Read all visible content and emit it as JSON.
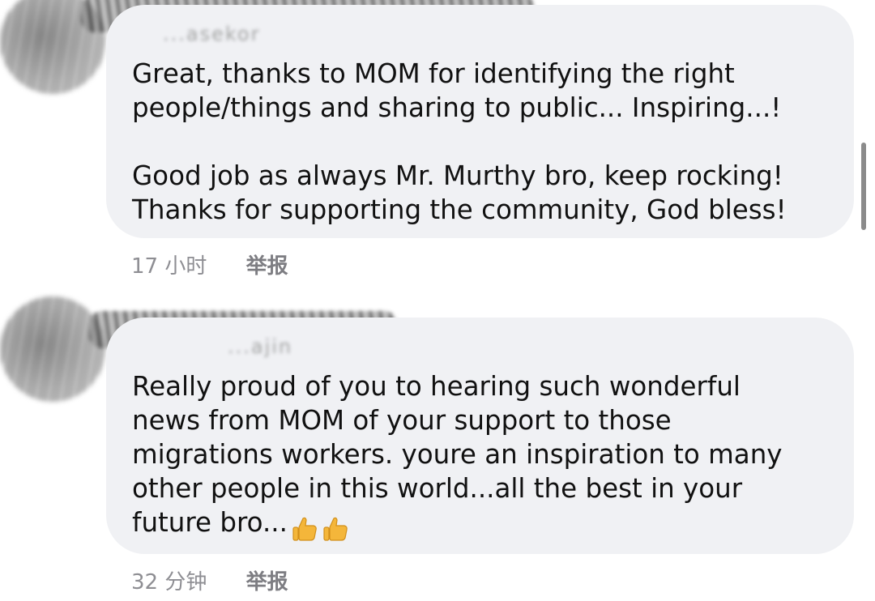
{
  "comments": [
    {
      "author": "...asekor",
      "text": "Great, thanks to MOM for identifying the right\npeople/things and sharing to public... Inspiring...!\n\nGood job as always Mr. Murthy bro, keep rocking!\nThanks for supporting the community, God bless!",
      "time": "17 小时",
      "report_label": "举报"
    },
    {
      "author": "...ajin",
      "text": "Really proud of you to hearing such wonderful\nnews from MOM of your support to those\nmigrations workers. youre an inspiration to many\nother people in this world...all the best in your\nfuture bro...",
      "emoji": [
        "thumbs-up-icon",
        "thumbs-up-icon"
      ],
      "time": "32 分钟",
      "report_label": "举报"
    }
  ],
  "colors": {
    "bubble_background": "#f0f1f4",
    "meta_text": "#8e8e93",
    "body_text": "#111111",
    "thumb_fill": "#f4b63a"
  }
}
